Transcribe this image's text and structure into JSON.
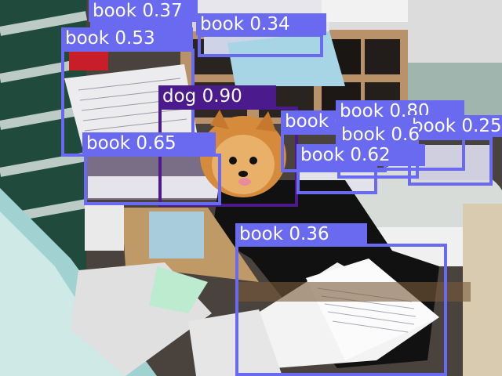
{
  "detections": [
    {
      "label": "book 0.37",
      "color": "#6a6af0"
    },
    {
      "label": "book 0.34",
      "color": "#6a6af0"
    },
    {
      "label": "book 0.53",
      "color": "#6a6af0"
    },
    {
      "label": "dog 0.90",
      "color": "#4b1a8c"
    },
    {
      "label": "book 0.65",
      "color": "#6a6af0"
    },
    {
      "label": "book 0.81",
      "color": "#6a6af0"
    },
    {
      "label": "book 0.80",
      "color": "#6a6af0"
    },
    {
      "label": "book 0.25",
      "color": "#6a6af0"
    },
    {
      "label": "book 0.62",
      "color": "#6a6af0"
    },
    {
      "label": "book 0.62",
      "color": "#6a6af0"
    },
    {
      "label": "book 0.36",
      "color": "#6a6af0"
    }
  ]
}
